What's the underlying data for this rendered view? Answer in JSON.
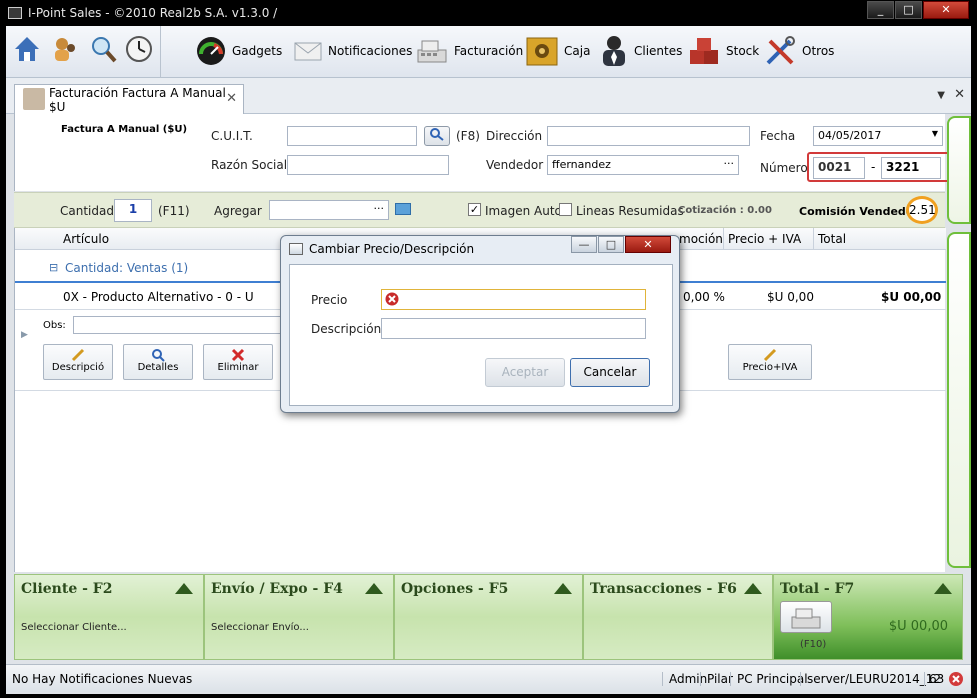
{
  "window": {
    "title": "I-Point Sales  - ©2010 Real2b S.A. v1.3.0 /",
    "buttons": [
      "_",
      "□",
      "✕"
    ]
  },
  "toolbar": {
    "items": [
      "Gadgets",
      "Notificaciones",
      "Facturación",
      "Caja",
      "Clientes",
      "Stock",
      "Otros"
    ]
  },
  "tab": {
    "label": "Facturación Factura A Manual $U",
    "close": "✕"
  },
  "form": {
    "heading": "Factura A Manual ($U)",
    "cuit_label": "C.U.I.T.",
    "cuit_value": "",
    "f8": "(F8)",
    "direccion_label": "Dirección",
    "direccion_value": "",
    "fecha_label": "Fecha",
    "fecha_value": "04/05/2017",
    "razon_label": "Razón Social",
    "razon_value": "",
    "vendedor_label": "Vendedor",
    "vendedor_value": "ffernandez",
    "dots": "···",
    "numero_label": "Número",
    "numero_serie": "0021",
    "numero_sep": "-",
    "numero_num": "3221"
  },
  "qty": {
    "cantidad_label": "Cantidad",
    "cantidad_value": "1",
    "f11": "(F11)",
    "agregar_label": "Agregar",
    "agregar_value": "",
    "dots": "···",
    "imagen_auto": "Imagen Auto",
    "lineas": "Lineas Resumidas",
    "cotizacion": "Cotización   : 0.00",
    "comision_label": "Comisión Vendedor",
    "comision_value": "2.51"
  },
  "grid": {
    "headers": [
      "Artículo",
      "moción",
      "Precio + IVA",
      "Total"
    ],
    "group": "Cantidad: Ventas (1)",
    "group_toggle": "⊟",
    "row": {
      "articulo": "0X - Producto Alternativo - 0 - U",
      "promo": "0,00 %",
      "precio": "$U 0,00",
      "total": "$U 00,00"
    },
    "obs_label": "Obs:",
    "buttons": [
      "Descripció",
      "Detalles",
      "Eliminar",
      "Precio+IVA"
    ]
  },
  "dialog": {
    "title": "Cambiar Precio/Descripción",
    "precio_label": "Precio",
    "precio_value": "",
    "descripcion_label": "Descripción",
    "descripcion_value": "",
    "aceptar": "Aceptar",
    "cancelar": "Cancelar",
    "buttons": [
      "—",
      "□",
      "✕"
    ]
  },
  "panels": [
    {
      "title": "Cliente - F2",
      "sub": "Seleccionar Cliente..."
    },
    {
      "title": "Envío / Expo - F4",
      "sub": "Seleccionar Envío..."
    },
    {
      "title": "Opciones - F5",
      "sub": ""
    },
    {
      "title": "Transacciones - F6",
      "sub": ""
    },
    {
      "title": "Total - F7",
      "sub": "(F10)",
      "total": "$U 00,00"
    }
  ],
  "status": {
    "left": "No Hay Notificaciones Nuevas",
    "right": [
      "Admin",
      "Pilar",
      "PC Principal",
      "server/LEURU2014_12",
      "63"
    ]
  }
}
